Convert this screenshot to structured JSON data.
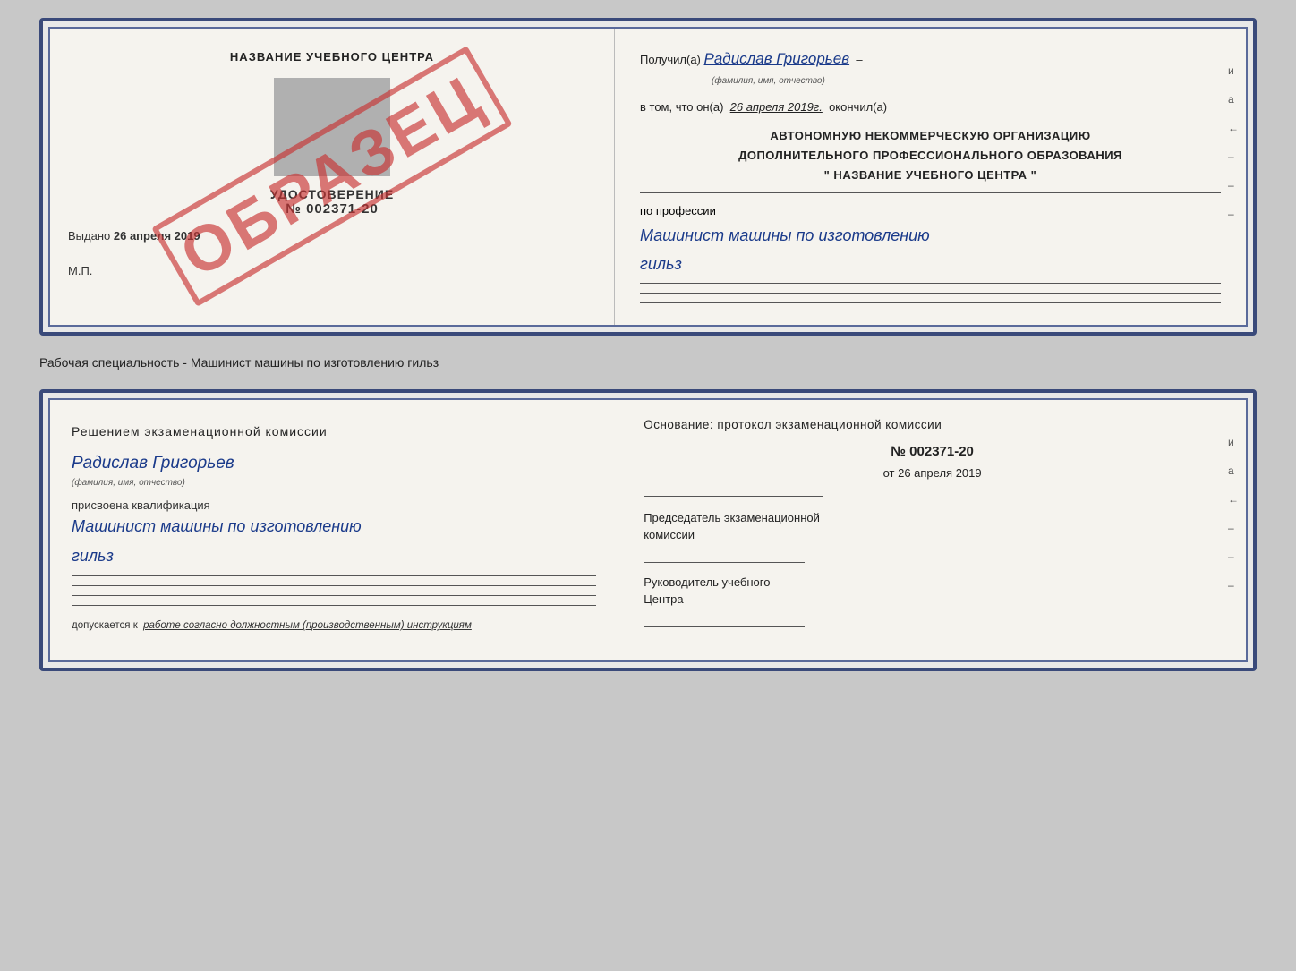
{
  "top_doc": {
    "left": {
      "title": "НАЗВАНИЕ УЧЕБНОГО ЦЕНТРА",
      "udostoverenie_label": "УДОСТОВЕРЕНИЕ",
      "udostoverenie_num": "№ 002371-20",
      "vydano_text": "Выдано",
      "vydano_date": "26 апреля 2019",
      "mp": "М.П.",
      "stamp": "ОБРАЗЕЦ"
    },
    "right": {
      "poluchil_label": "Получил(а)",
      "poluchil_name": "Радислав Григорьев",
      "fio_label": "(фамилия, имя, отчество)",
      "dash": "–",
      "vtom_label": "в том, что он(а)",
      "vtom_date": "26 апреля 2019г.",
      "okonchil": "окончил(а)",
      "org_line1": "АВТОНОМНУЮ НЕКОММЕРЧЕСКУЮ ОРГАНИЗАЦИЮ",
      "org_line2": "ДОПОЛНИТЕЛЬНОГО ПРОФЕССИОНАЛЬНОГО ОБРАЗОВАНИЯ",
      "org_line3": "\"   НАЗВАНИЕ УЧЕБНОГО ЦЕНТРА   \"",
      "po_professii": "по профессии",
      "profession_line1": "Машинист машины по изготовлению",
      "profession_line2": "гильз",
      "side_letters": [
        "и",
        "а",
        "←",
        "–",
        "–",
        "–"
      ]
    }
  },
  "specialty_text": "Рабочая специальность - Машинист машины по изготовлению гильз",
  "bottom_doc": {
    "left": {
      "decision_label": "Решением  экзаменационной  комиссии",
      "name": "Радислав Григорьев",
      "fio_label": "(фамилия, имя, отчество)",
      "prisvoena": "присвоена квалификация",
      "kval_line1": "Машинист машины по изготовлению",
      "kval_line2": "гильз",
      "dopuskaetsya": "допускается к",
      "dopusk_text": "работе согласно должностным (производственным) инструкциям"
    },
    "right": {
      "osnov_label": "Основание: протокол экзаменационной  комиссии",
      "protocol_num": "№  002371-20",
      "ot_label": "от",
      "protocol_date": "26 апреля 2019",
      "predsedatel_label": "Председатель экзаменационной",
      "komissii_label": "комиссии",
      "rukovoditel_label": "Руководитель учебного",
      "tsentra_label": "Центра",
      "side_letters": [
        "и",
        "а",
        "←",
        "–",
        "–",
        "–"
      ]
    }
  }
}
